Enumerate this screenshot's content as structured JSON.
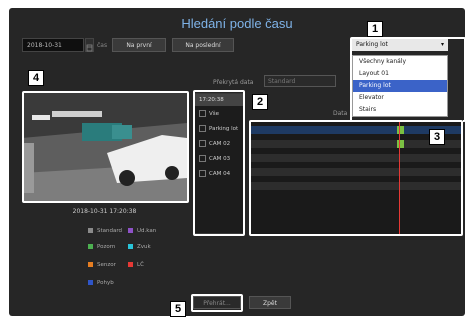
{
  "title": "Hledání podle času",
  "date": "2018-10-31",
  "date_unit": "čas",
  "buttons": {
    "first": "Na první",
    "last": "Na poslední",
    "back": "Zpět",
    "playback": "Přehrát..."
  },
  "overlap_label": "Překrytá data",
  "overlap_value": "Standard",
  "timeline_label": "Data",
  "dropdown": {
    "selected": "Parking lot",
    "options": [
      "Všechny kanály",
      "Layout 01",
      "Parking lot",
      "Elevator",
      "Stairs"
    ],
    "highlighted_index": 2
  },
  "timestamp": "2018-10-31 17:20:38",
  "channel_panel": {
    "time": "17:20:38",
    "items": [
      "Vše",
      "Parking lot",
      "CAM 02",
      "CAM 03",
      "CAM 04"
    ]
  },
  "legend": [
    {
      "label": "Standard",
      "color": "#8a8a8a"
    },
    {
      "label": "Ud.kan",
      "color": "#8e52c8"
    },
    {
      "label": "Pozorn",
      "color": "#4caf50"
    },
    {
      "label": "Zvuk",
      "color": "#29c4d8"
    },
    {
      "label": "Senzor",
      "color": "#e67e22"
    },
    {
      "label": "LČ",
      "color": "#e53935"
    },
    {
      "label": "Pohyb",
      "color": "#2f55c8"
    }
  ],
  "callouts": [
    "1",
    "2",
    "3",
    "4",
    "5"
  ],
  "icons": {
    "calendar": "calendar-icon",
    "dropdown": "chevron-down-icon"
  },
  "colors": {
    "accent": "#3b63c8",
    "marker": "#e53935",
    "title": "#7fb3e8"
  }
}
